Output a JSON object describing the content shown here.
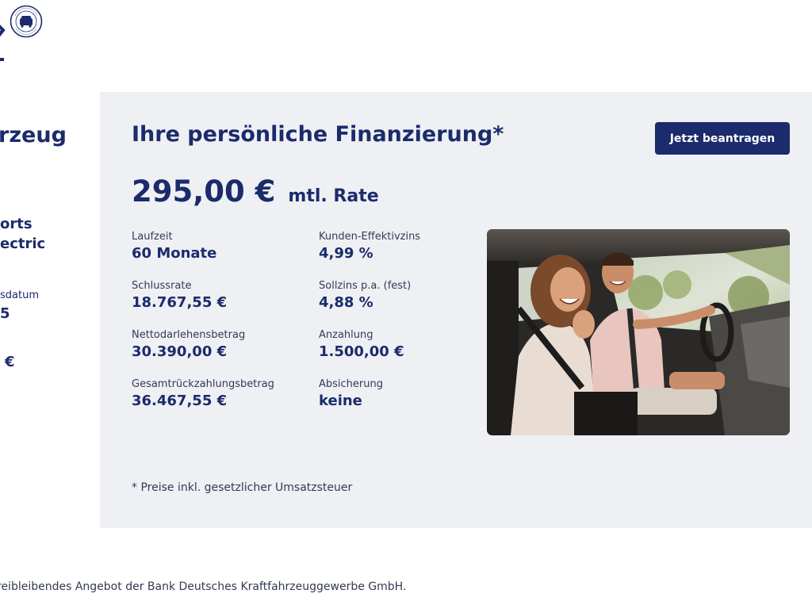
{
  "left": {
    "title": "rzeug",
    "model_line_1": "orts",
    "model_line_2": "ectric",
    "date_label": "sdatum",
    "date_value": "5",
    "price_value": "€"
  },
  "finance": {
    "title": "Ihre persönliche Finanzierung*",
    "apply_label": "Jetzt beantragen",
    "rate_amount": "295,00 €",
    "rate_suffix": "mtl. Rate",
    "details": [
      {
        "label": "Laufzeit",
        "value": "60 Monate"
      },
      {
        "label": "Kunden-Effektivzins",
        "value": "4,99 %"
      },
      {
        "label": "Schlussrate",
        "value": "18.767,55 €"
      },
      {
        "label": "Sollzins p.a. (fest)",
        "value": "4,88 %"
      },
      {
        "label": "Nettodarlehensbetrag",
        "value": "30.390,00 €"
      },
      {
        "label": "Anzahlung",
        "value": "1.500,00 €"
      },
      {
        "label": "Gesamtrückzahlungsbetrag",
        "value": "36.467,55 €"
      },
      {
        "label": "Absicherung",
        "value": "keine"
      }
    ],
    "footnote": "* Preise inkl. gesetzlicher Umsatzsteuer"
  },
  "disclaimer": "reibleibendes Angebot der Bank Deutsches Kraftfahrzeuggewerbe GmbH.",
  "colors": {
    "brand": "#1b2b6b",
    "panel_bg": "#eef0f4"
  }
}
